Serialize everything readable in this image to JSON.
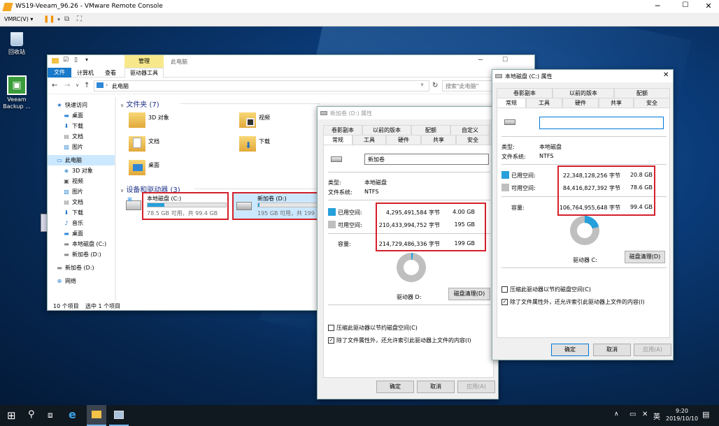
{
  "vmrc": {
    "title": "WS19-Veeam_96.26 - VMware Remote Console",
    "menu_label": "VMRC(V)"
  },
  "desktop": {
    "icons": [
      {
        "label": "回收站",
        "icon": "recycle-bin-icon"
      },
      {
        "label": "Veeam Backup ...",
        "icon": "veeam-icon"
      }
    ]
  },
  "explorer": {
    "ribbon_context": "管理",
    "window_title": "此电脑",
    "tabs": [
      "文件",
      "计算机",
      "查看",
      "驱动器工具"
    ],
    "address": "此电脑",
    "search_placeholder": "搜索\"此电脑\"",
    "nav": [
      {
        "label": "快速访问",
        "icon": "star-icon",
        "level": 0
      },
      {
        "label": "桌面",
        "icon": "desktop-icon",
        "level": 1
      },
      {
        "label": "下载",
        "icon": "download-icon",
        "level": 1
      },
      {
        "label": "文档",
        "icon": "document-icon",
        "level": 1
      },
      {
        "label": "图片",
        "icon": "picture-icon",
        "level": 1
      },
      {
        "label": "此电脑",
        "icon": "computer-icon",
        "level": 0
      },
      {
        "label": "3D 对象",
        "icon": "cube-icon",
        "level": 1
      },
      {
        "label": "视频",
        "icon": "video-icon",
        "level": 1
      },
      {
        "label": "图片",
        "icon": "picture-icon",
        "level": 1
      },
      {
        "label": "文档",
        "icon": "document-icon",
        "level": 1
      },
      {
        "label": "下载",
        "icon": "download-icon",
        "level": 1
      },
      {
        "label": "音乐",
        "icon": "music-icon",
        "level": 1
      },
      {
        "label": "桌面",
        "icon": "desktop-icon",
        "level": 1
      },
      {
        "label": "本地磁盘 (C:)",
        "icon": "drive-icon",
        "level": 1
      },
      {
        "label": "新加卷 (D:)",
        "icon": "drive-icon",
        "level": 1
      },
      {
        "label": "新加卷 (D:)",
        "icon": "drive-icon",
        "level": 0
      },
      {
        "label": "网络",
        "icon": "network-icon",
        "level": 0
      }
    ],
    "folders_header": "文件夹 (7)",
    "folders": [
      "3D 对象",
      "视频",
      "文档",
      "下载",
      "桌面"
    ],
    "devices_header": "设备和驱动器 (3)",
    "drives": [
      {
        "name": "本地磁盘 (C:)",
        "info": "78.5 GB 可用，共 99.4 GB",
        "used_fraction": 0.21
      },
      {
        "name": "新加卷 (D:)",
        "info": "195 GB 可用，共 199 GB",
        "used_fraction": 0.02
      }
    ],
    "status_count": "10 个项目",
    "status_selected": "选中 1 个项目"
  },
  "dlg_d": {
    "title": "新加卷 (D:) 属性",
    "tabs_top": [
      "卷影副本",
      "以前的版本",
      "配额",
      "自定义"
    ],
    "tabs_bottom": [
      "常规",
      "工具",
      "硬件",
      "共享",
      "安全"
    ],
    "name_value": "新加卷",
    "type_label": "类型:",
    "type_value": "本地磁盘",
    "fs_label": "文件系统:",
    "fs_value": "NTFS",
    "used_label": "已用空间:",
    "used_bytes": "4,295,491,584 字节",
    "used_gb": "4.00 GB",
    "free_label": "可用空间:",
    "free_bytes": "210,433,994,752 字节",
    "free_gb": "195 GB",
    "cap_label": "容量:",
    "cap_bytes": "214,729,486,336 字节",
    "cap_gb": "199 GB",
    "drive_label": "驱动器 D:",
    "cleanup": "磁盘清理(D)",
    "compress": "压缩此驱动器以节约磁盘空间(C)",
    "index": "除了文件属性外，还允许索引此驱动器上文件的内容(I)",
    "ok": "确定",
    "cancel": "取消",
    "apply": "应用(A)",
    "used_fraction": 0.02
  },
  "dlg_c": {
    "title": "本地磁盘 (C:) 属性",
    "tabs_top": [
      "卷影副本",
      "以前的版本",
      "配额"
    ],
    "tabs_bottom": [
      "常规",
      "工具",
      "硬件",
      "共享",
      "安全"
    ],
    "name_value": "",
    "type_label": "类型:",
    "type_value": "本地磁盘",
    "fs_label": "文件系统:",
    "fs_value": "NTFS",
    "used_label": "已用空间:",
    "used_bytes": "22,348,128,256 字节",
    "used_gb": "20.8 GB",
    "free_label": "可用空间:",
    "free_bytes": "84,416,827,392 字节",
    "free_gb": "78.6 GB",
    "cap_label": "容量:",
    "cap_bytes": "106,764,955,648 字节",
    "cap_gb": "99.4 GB",
    "drive_label": "驱动器 C:",
    "cleanup": "磁盘清理(D)",
    "compress": "压缩此驱动器以节约磁盘空间(C)",
    "index": "除了文件属性外，还允许索引此驱动器上文件的内容(I)",
    "ok": "确定",
    "cancel": "取消",
    "apply": "应用(A)",
    "used_fraction": 0.21
  },
  "taskbar": {
    "ime": "英",
    "time": "9:20",
    "date": "2019/10/10"
  },
  "colors": {
    "used": "#26a0da",
    "free": "#bfbfbf",
    "highlight": "#d4202a",
    "accent": "#0078d7"
  }
}
